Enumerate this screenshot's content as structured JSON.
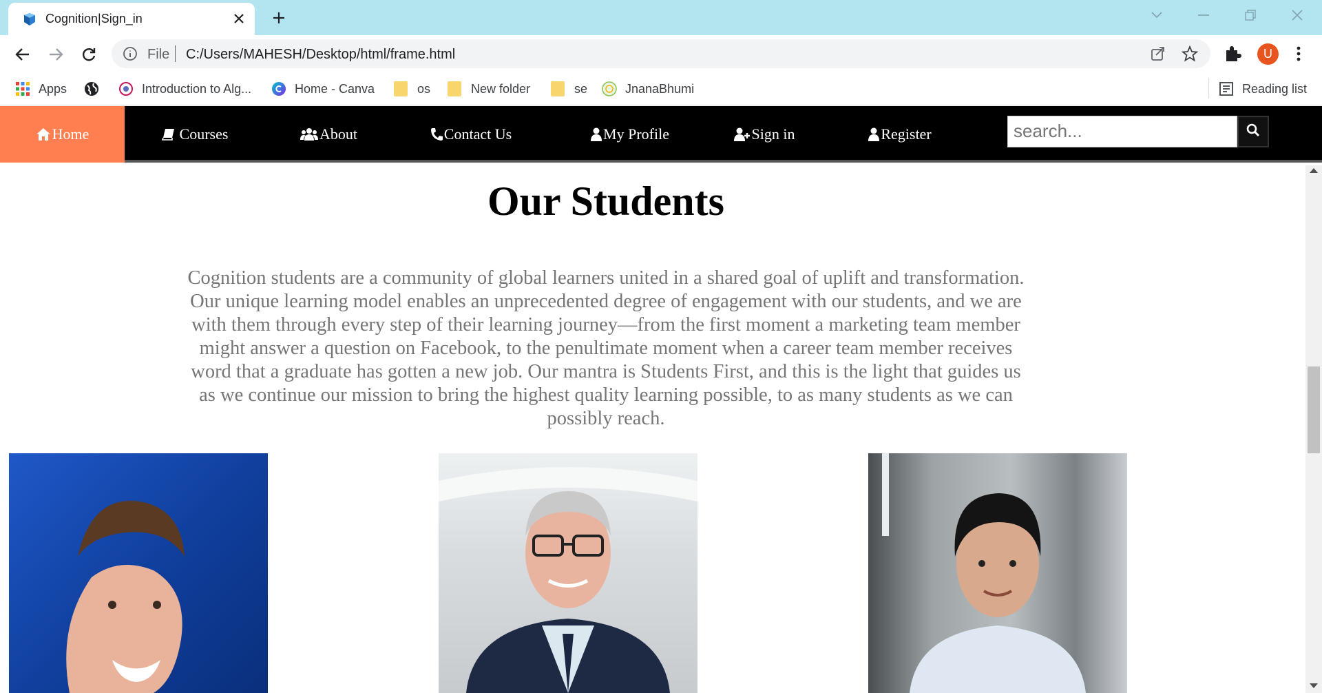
{
  "browser": {
    "tab_title": "Cognition|Sign_in",
    "address_scheme": "File",
    "address_url": "C:/Users/MAHESH/Desktop/html/frame.html",
    "profile_initial": "U",
    "bookmarks": [
      {
        "label": "Apps",
        "icon": "apps-grid-icon"
      },
      {
        "label": "",
        "icon": "globe-icon"
      },
      {
        "label": "Introduction to Alg...",
        "icon": "site-favicon-icon"
      },
      {
        "label": "Home - Canva",
        "icon": "canva-icon"
      },
      {
        "label": "os",
        "icon": "folder-icon"
      },
      {
        "label": "New folder",
        "icon": "folder-icon"
      },
      {
        "label": "se",
        "icon": "folder-icon"
      },
      {
        "label": "JnanaBhumi",
        "icon": "jnanabhumi-icon"
      }
    ],
    "reading_list": "Reading list"
  },
  "nav": {
    "items": [
      {
        "label": "Home",
        "icon": "home-icon",
        "active": true
      },
      {
        "label": "Courses",
        "icon": "book-icon"
      },
      {
        "label": "About",
        "icon": "users-icon"
      },
      {
        "label": "Contact Us",
        "icon": "phone-icon"
      },
      {
        "label": "My Profile",
        "icon": "user-icon"
      },
      {
        "label": "Sign in",
        "icon": "user-plus-icon"
      },
      {
        "label": "Register",
        "icon": "user-icon"
      }
    ],
    "search_placeholder": "search...",
    "accent": "#ff7f50"
  },
  "main": {
    "heading": "Our Students",
    "paragraph": "Cognition students are a community of global learners united in a shared goal of uplift and transformation. Our unique learning model enables an unprecedented degree of engagement with our students, and we are with them through every step of their learning journey—from the first moment a marketing team member might answer a question on Facebook, to the penultimate moment when a career team member receives word that a graduate has gotten a new job. Our mantra is Students First, and this is the light that guides us as we continue our mission to bring the highest quality learning possible, to as many students as we can possibly reach."
  }
}
